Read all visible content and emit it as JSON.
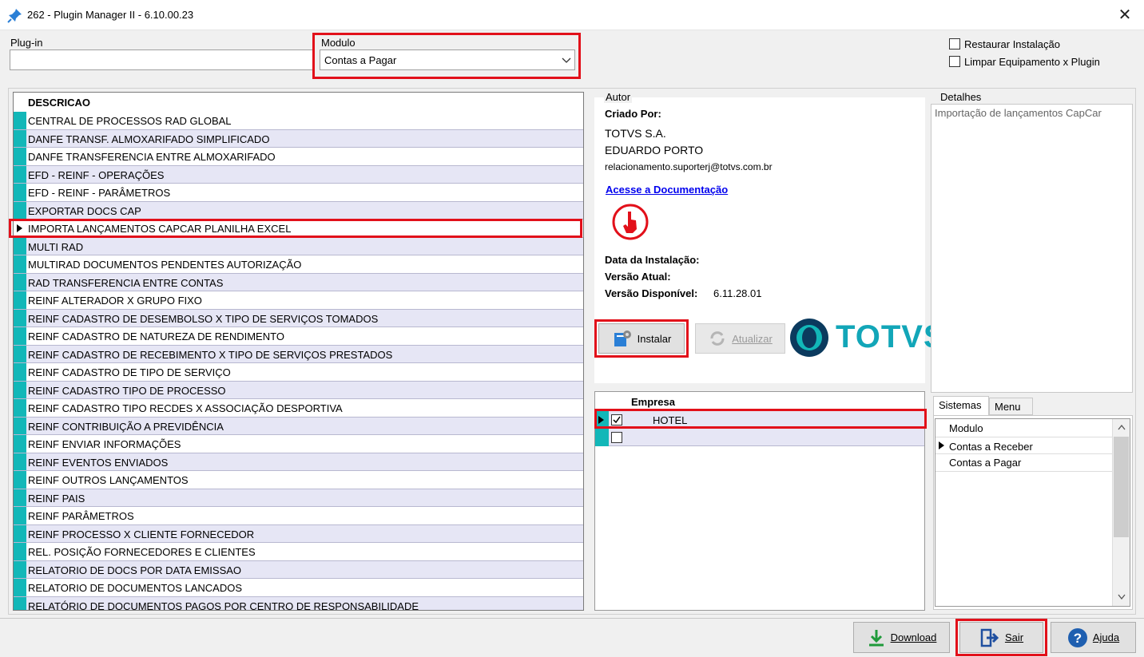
{
  "window": {
    "title": "262 - Plugin Manager II - 6.10.00.23",
    "close_glyph": "✕"
  },
  "filters": {
    "plugin_label": "Plug-in",
    "plugin_value": "",
    "modulo_label": "Modulo",
    "modulo_value": "Contas a Pagar",
    "restaurar_label": "Restaurar Instalação",
    "limpar_label": "Limpar Equipamento x Plugin"
  },
  "plugins": {
    "header": "DESCRICAO",
    "selected_index": 6,
    "items": [
      "CENTRAL DE PROCESSOS RAD GLOBAL",
      "DANFE TRANSF. ALMOXARIFADO SIMPLIFICADO",
      "DANFE TRANSFERENCIA ENTRE ALMOXARIFADO",
      "EFD - REINF - OPERAÇÕES",
      "EFD - REINF - PARÂMETROS",
      "EXPORTAR DOCS CAP",
      "IMPORTA LANÇAMENTOS CAPCAR PLANILHA EXCEL",
      "MULTI RAD",
      "MULTIRAD DOCUMENTOS PENDENTES AUTORIZAÇÃO",
      "RAD TRANSFERENCIA ENTRE CONTAS",
      "REINF ALTERADOR X GRUPO FIXO",
      "REINF CADASTRO DE DESEMBOLSO X TIPO DE SERVIÇOS TOMADOS",
      "REINF CADASTRO DE NATUREZA DE RENDIMENTO",
      "REINF CADASTRO DE RECEBIMENTO X TIPO DE SERVIÇOS PRESTADOS",
      "REINF CADASTRO DE TIPO DE SERVIÇO",
      "REINF CADASTRO TIPO DE PROCESSO",
      "REINF CADASTRO TIPO RECDES X ASSOCIAÇÃO DESPORTIVA",
      "REINF CONTRIBUIÇÃO A PREVIDÊNCIA",
      "REINF ENVIAR  INFORMAÇÕES",
      "REINF EVENTOS ENVIADOS",
      "REINF OUTROS LANÇAMENTOS",
      "REINF PAIS",
      "REINF PARÂMETROS",
      "REINF PROCESSO X CLIENTE FORNECEDOR",
      "REL. POSIÇÃO FORNECEDORES E CLIENTES",
      "RELATORIO DE DOCS POR DATA EMISSAO",
      "RELATORIO DE DOCUMENTOS LANCADOS",
      "RELATÓRIO DE DOCUMENTOS PAGOS POR CENTRO DE RESPONSABILIDADE"
    ]
  },
  "autor": {
    "group_label": "Autor",
    "criado_por_label": "Criado Por:",
    "company": "TOTVS S.A.",
    "author": "EDUARDO PORTO",
    "email": "relacionamento.suporterj@totvs.com.br",
    "doc_link": "Acesse a Documentação",
    "data_instalacao_label": "Data da Instalação:",
    "versao_atual_label": "Versão Atual:",
    "versao_disponivel_label": "Versão Disponível:",
    "versao_disponivel_value": "6.11.28.01",
    "instalar_label": "Instalar",
    "atualizar_label": "Atualizar",
    "logo_text": "TOTVS"
  },
  "detalhes": {
    "group_label": "Detalhes",
    "text": "Importação de lançamentos CapCar"
  },
  "empresa": {
    "header": "Empresa",
    "rows": [
      {
        "name": "HOTEL",
        "checked": true
      },
      {
        "name": "",
        "checked": false
      }
    ]
  },
  "sistemas": {
    "tabs": [
      "Sistemas",
      "Menu"
    ],
    "header": "Modulo",
    "items": [
      "Contas a Receber",
      "Contas a Pagar"
    ]
  },
  "footer": {
    "download_label": "Download",
    "sair_label": "Sair",
    "ajuda_label": "Ajuda"
  },
  "colors": {
    "accent": "#12b7b8",
    "highlight": "#e2101a",
    "row_alt": "#e6e6f5"
  }
}
